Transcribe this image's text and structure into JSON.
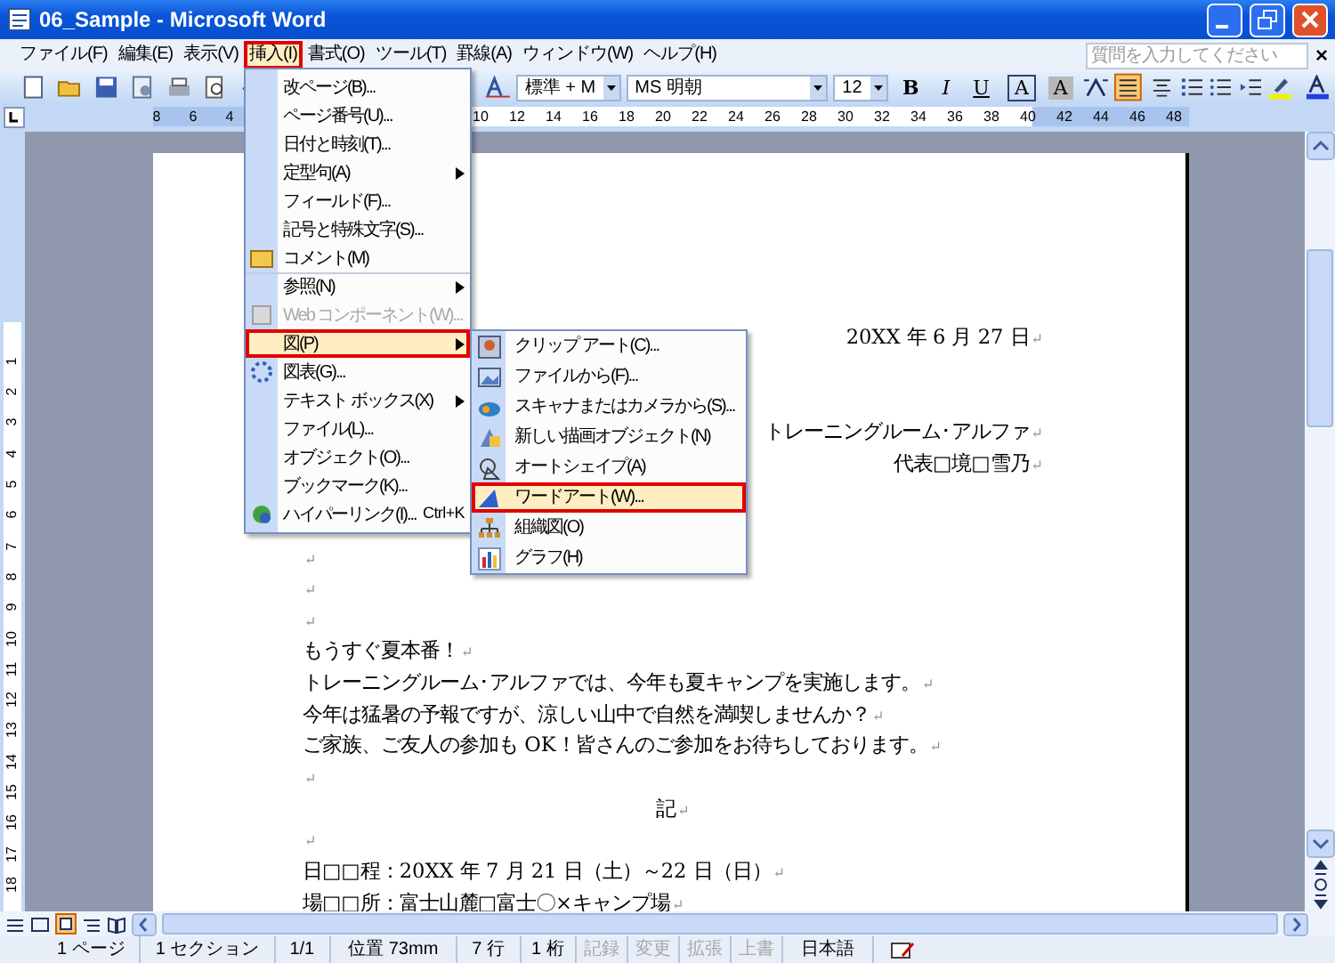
{
  "window": {
    "title": "06_Sample - Microsoft Word"
  },
  "menu_bar": {
    "items": [
      {
        "label": "ファイル(F)",
        "selected": false
      },
      {
        "label": "編集(E)",
        "selected": false
      },
      {
        "label": "表示(V)",
        "selected": false
      },
      {
        "label": "挿入(I)",
        "selected": true
      },
      {
        "label": "書式(O)",
        "selected": false
      },
      {
        "label": "ツール(T)",
        "selected": false
      },
      {
        "label": "罫線(A)",
        "selected": false
      },
      {
        "label": "ウィンドウ(W)",
        "selected": false
      },
      {
        "label": "ヘルプ(H)",
        "selected": false
      }
    ],
    "help_search": {
      "placeholder": "質問を入力してください"
    },
    "close_label": "×"
  },
  "formatting_toolbar": {
    "style": "標準 + M",
    "font": "MS 明朝",
    "size": "12",
    "buttons": [
      {
        "label": "B",
        "kind": "bold"
      },
      {
        "label": "I",
        "kind": "italic"
      },
      {
        "label": "U",
        "kind": "underline"
      },
      {
        "label": "A",
        "kind": "border"
      },
      {
        "label": "A",
        "kind": "shade"
      }
    ],
    "alignment": [
      {
        "kind": "justify",
        "selected": true
      },
      {
        "kind": "center",
        "selected": false
      }
    ]
  },
  "ruler": {
    "left_numbers": [
      "8",
      "6",
      "4"
    ],
    "right_numbers": [
      "10",
      "12",
      "14",
      "16",
      "18",
      "20",
      "22",
      "24",
      "26",
      "28",
      "30",
      "32",
      "34",
      "36",
      "38",
      "40",
      "42",
      "44",
      "46",
      "48"
    ]
  },
  "vertical_ruler": {
    "numbers": [
      "1",
      "2",
      "3",
      "4",
      "5",
      "6",
      "7",
      "8",
      "9",
      "10",
      "11",
      "12",
      "13",
      "14",
      "15",
      "16",
      "17",
      "18"
    ]
  },
  "insert_menu": [
    {
      "label": "改ページ(B)...",
      "selected": false,
      "disabled": false,
      "has_submenu": false,
      "separator_before": false
    },
    {
      "label": "ページ番号(U)...",
      "selected": false,
      "disabled": false,
      "has_submenu": false,
      "separator_before": false
    },
    {
      "label": "日付と時刻(T)...",
      "selected": false,
      "disabled": false,
      "has_submenu": false,
      "separator_before": false
    },
    {
      "label": "定型句(A)",
      "selected": false,
      "disabled": false,
      "has_submenu": true,
      "separator_before": false
    },
    {
      "label": "フィールド(F)...",
      "selected": false,
      "disabled": false,
      "has_submenu": false,
      "separator_before": false
    },
    {
      "label": "記号と特殊文字(S)...",
      "selected": false,
      "disabled": false,
      "has_submenu": false,
      "separator_before": false
    },
    {
      "label": "コメント(M)",
      "selected": false,
      "disabled": false,
      "has_submenu": false,
      "separator_before": false
    },
    {
      "label": "参照(N)",
      "selected": false,
      "disabled": false,
      "has_submenu": true,
      "separator_before": true
    },
    {
      "label": "Web コンポーネント(W)...",
      "selected": false,
      "disabled": true,
      "has_submenu": false,
      "separator_before": false
    },
    {
      "label": "図(P)",
      "selected": true,
      "disabled": false,
      "has_submenu": true,
      "separator_before": true
    },
    {
      "label": "図表(G)...",
      "selected": false,
      "disabled": false,
      "has_submenu": false,
      "separator_before": false
    },
    {
      "label": "テキスト ボックス(X)",
      "selected": false,
      "disabled": false,
      "has_submenu": true,
      "separator_before": false
    },
    {
      "label": "ファイル(L)...",
      "selected": false,
      "disabled": false,
      "has_submenu": false,
      "separator_before": false
    },
    {
      "label": "オブジェクト(O)...",
      "selected": false,
      "disabled": false,
      "has_submenu": false,
      "separator_before": false
    },
    {
      "label": "ブックマーク(K)...",
      "selected": false,
      "disabled": false,
      "has_submenu": false,
      "separator_before": false
    },
    {
      "label": "ハイパーリンク(I)...",
      "shortcut": "Ctrl+K",
      "selected": false,
      "disabled": false,
      "has_submenu": false,
      "separator_before": false
    }
  ],
  "picture_submenu": [
    {
      "label": "クリップ アート(C)...",
      "selected": false
    },
    {
      "label": "ファイルから(F)...",
      "selected": false
    },
    {
      "label": "スキャナまたはカメラから(S)...",
      "selected": false
    },
    {
      "label": "新しい描画オブジェクト(N)",
      "selected": false
    },
    {
      "label": "オートシェイプ(A)",
      "selected": false
    },
    {
      "label": "ワードアート(W)...",
      "selected": true
    },
    {
      "label": "組織図(O)",
      "selected": false
    },
    {
      "label": "グラフ(H)",
      "selected": false
    }
  ],
  "document": {
    "lines": [
      {
        "text": "20XX 年 6 月 27 日",
        "mark": "↵",
        "kind": "right"
      },
      {
        "text": "トレーニングルーム･アルファ",
        "mark": "↵",
        "kind": "right"
      },
      {
        "text": "代表□境□雪乃",
        "mark": "↵",
        "kind": "right"
      },
      {
        "mark": "↵",
        "kind": "left"
      },
      {
        "mark": "↵",
        "kind": "left"
      },
      {
        "mark": "↵",
        "kind": "left"
      },
      {
        "text": "もうすぐ夏本番！",
        "mark": "↵",
        "kind": "left"
      },
      {
        "text": "トレーニングルーム･アルファでは、今年も夏キャンプを実施します。",
        "mark": "↵",
        "kind": "left"
      },
      {
        "text": "今年は猛暑の予報ですが、涼しい山中で自然を満喫しませんか？",
        "mark": "↵",
        "kind": "left"
      },
      {
        "text": "ご家族、ご友人の参加も OK！皆さんのご参加をお待ちしております。",
        "mark": "↵",
        "kind": "left"
      },
      {
        "mark": "↵",
        "kind": "left"
      },
      {
        "text": "記",
        "mark": "↵",
        "kind": "center"
      },
      {
        "mark": "↵",
        "kind": "left"
      },
      {
        "text": "日□□程：20XX 年 7 月 21 日（土）～22 日（日）",
        "mark": "↵",
        "kind": "left"
      },
      {
        "text": "場□□所：富士山麓□富士〇×キャンプ場",
        "mark": "↵",
        "kind": "left"
      }
    ]
  },
  "status_bar": [
    {
      "text": "1 ページ",
      "disabled": false
    },
    {
      "text": "1 セクション",
      "disabled": false
    },
    {
      "text": "1/1",
      "disabled": false
    },
    {
      "text": "位置 73mm",
      "disabled": false
    },
    {
      "text": "7 行",
      "disabled": false
    },
    {
      "text": "1 桁",
      "disabled": false
    },
    {
      "text": "記録",
      "disabled": true
    },
    {
      "text": "変更",
      "disabled": true
    },
    {
      "text": "拡張",
      "disabled": true
    },
    {
      "text": "上書",
      "disabled": true
    },
    {
      "text": "日本語",
      "disabled": false
    }
  ]
}
